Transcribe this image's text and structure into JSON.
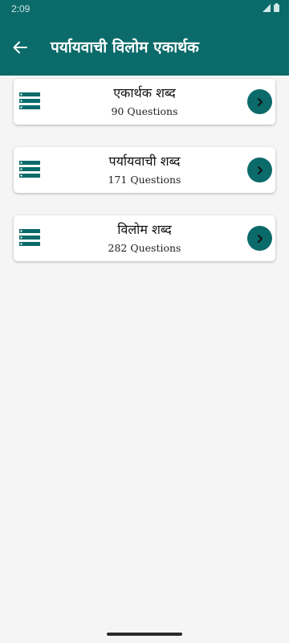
{
  "status": {
    "time": "2:09"
  },
  "app": {
    "title": "पर्यायवाची विलोम एकार्थक"
  },
  "colors": {
    "primary": "#0b6a6a",
    "background": "#f5f5f5",
    "card": "#ffffff"
  },
  "icons": {
    "back": "arrow-left-icon",
    "list": "list-icon",
    "go": "chevron-right-icon"
  },
  "items": [
    {
      "title": "एकार्थक शब्द",
      "subtitle": "90 Questions"
    },
    {
      "title": "पर्यायवाची शब्द",
      "subtitle": "171 Questions"
    },
    {
      "title": "विलोम शब्द",
      "subtitle": "282 Questions"
    }
  ]
}
